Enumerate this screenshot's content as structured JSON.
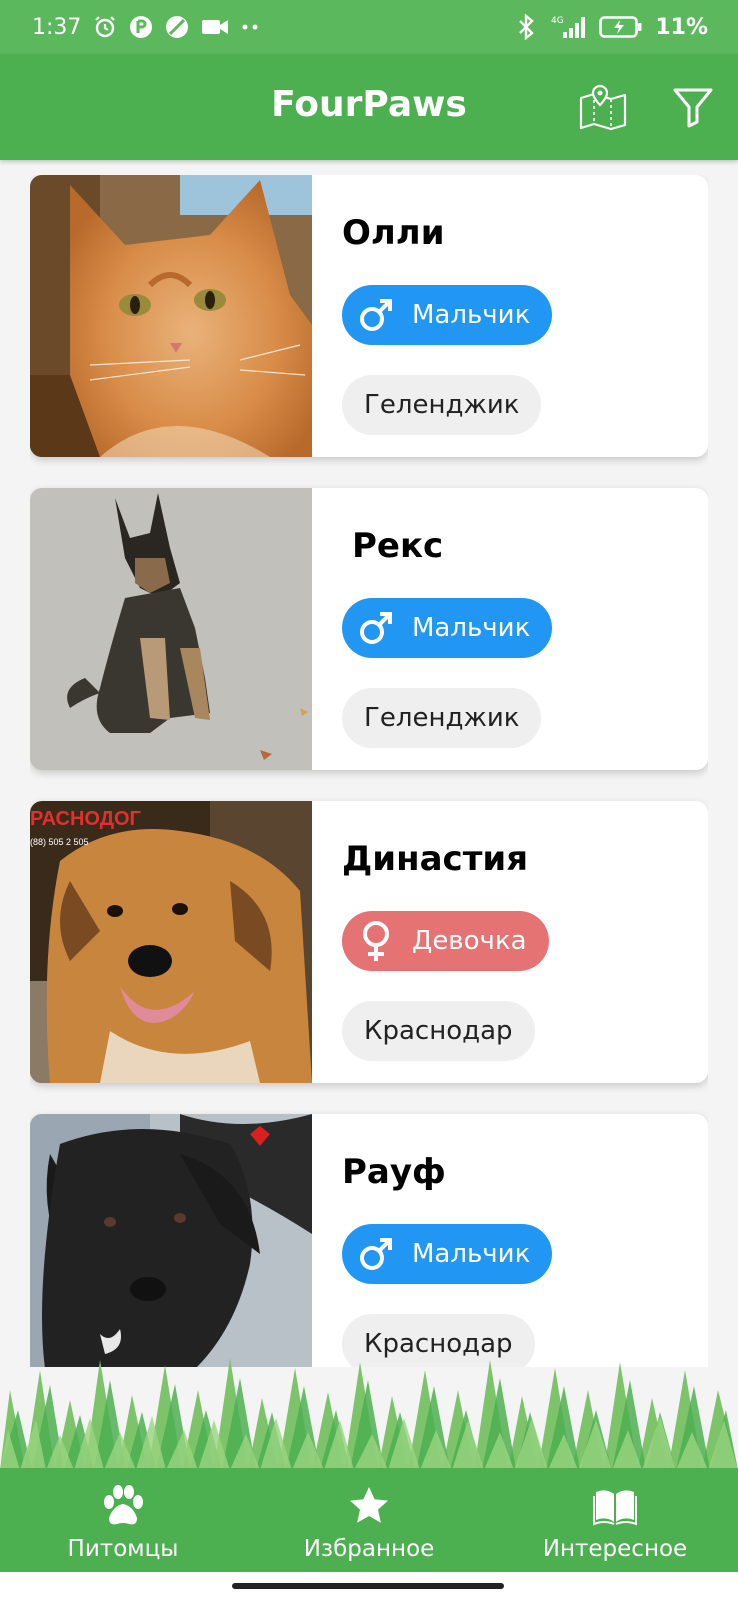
{
  "status_bar": {
    "time": "1:37",
    "network": "4G",
    "battery": "11%"
  },
  "app_bar": {
    "title": "FourPaws",
    "map_icon": "map-pin-icon",
    "filter_icon": "filter-icon"
  },
  "pets": [
    {
      "name": "Олли",
      "gender": "Мальчик",
      "gender_type": "male",
      "city": "Геленджик",
      "photo": "orange-cat"
    },
    {
      "name": "Рекс",
      "gender": "Мальчик",
      "gender_type": "male",
      "city": "Геленджик",
      "photo": "shepherd-puppy"
    },
    {
      "name": "Династия",
      "gender": "Девочка",
      "gender_type": "female",
      "city": "Краснодар",
      "photo": "ginger-dog"
    },
    {
      "name": "Рауф",
      "gender": "Мальчик",
      "gender_type": "male",
      "city": "Краснодар",
      "photo": "black-puppy"
    }
  ],
  "photo_watermark": {
    "text": "РАСНОДОГ",
    "phone": "(88) 505 2 505"
  },
  "bottom_nav": [
    {
      "label": "Питомцы",
      "icon": "paw-icon"
    },
    {
      "label": "Избранное",
      "icon": "star-icon"
    },
    {
      "label": "Интересное",
      "icon": "book-icon"
    }
  ],
  "colors": {
    "primary": "#4caf50",
    "status_bar": "#5cb85c",
    "male": "#2196f3",
    "female": "#e57373",
    "chip": "#efefef"
  }
}
